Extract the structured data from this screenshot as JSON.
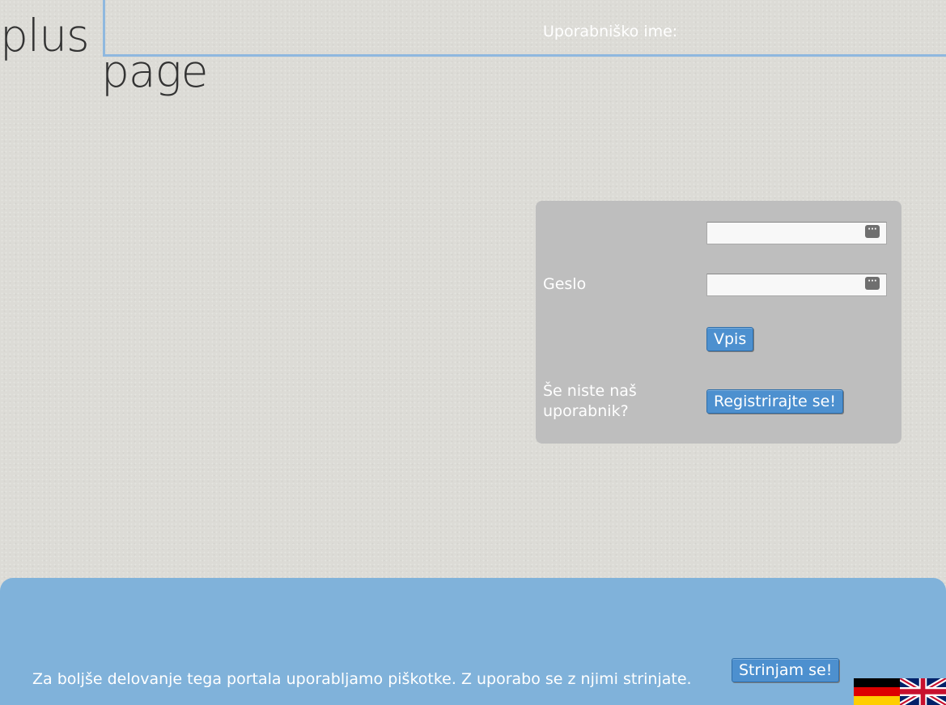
{
  "logo": {
    "word1": "plus",
    "word2": "page"
  },
  "login": {
    "username_label": "Uporabniško ime:",
    "username_value": "",
    "password_label": "Geslo",
    "password_value": "",
    "submit_label": "Vpis",
    "register_prompt": "Še niste naš uporabnik?",
    "register_label": "Registrirajte se!",
    "field_icon": "password-manager-icon"
  },
  "cookie": {
    "message": "Za boljše delovanje tega portala uporabljamo piškotke. Z uporabo se z njimi strinjate.",
    "accept_label": "Strinjam se!"
  },
  "languages": [
    {
      "code": "de",
      "icon": "german-flag-icon"
    },
    {
      "code": "en",
      "icon": "uk-flag-icon"
    }
  ],
  "colors": {
    "accent": "#80b2da",
    "button": "#4d90cf",
    "panel": "#bebebe",
    "logo_line": "#8fb8df"
  }
}
